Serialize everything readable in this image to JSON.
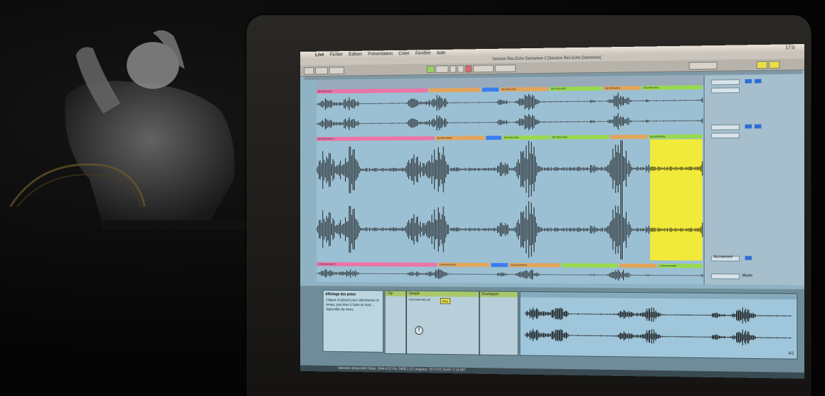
{
  "menu": {
    "app": "Live",
    "items": [
      "Fichier",
      "Édition",
      "Présentation",
      "Créer",
      "Fenêtre",
      "Aide"
    ],
    "clock": "17:0"
  },
  "window_title": "Session Rec.Echo Damonion 2  [Session Rec.Echo Damonion]",
  "tracks": {
    "top_clips": [
      "56 DPA 4021",
      "56 DPA 4021",
      "56 DPA 4021",
      "56 DPA 4021",
      "56 DPA 4021"
    ],
    "mid_clips": [
      "56 DPA 4061-1",
      "56 DPA 4061",
      "56 DPA 4061",
      "56 DPA 4061",
      "56 DPA 4061"
    ],
    "bottom_clips": [
      "2 Accouement 1",
      "2 Accouement",
      "2 Accouement",
      "2 Accouement"
    ],
    "bottom_lane_label": "Accouement"
  },
  "side": {
    "send_label": "Master",
    "lane_label": "Accouement"
  },
  "bottom": {
    "help_title": "Affichage des pistes",
    "help_text": "Cliquez et glissez pour sélectionner le temps, puis tirez à l'aide du bord ... disponible du menu.",
    "clip_title": "Clip",
    "sample_title": "Sample",
    "envelopes_title": "Enveloppes",
    "sample_name": "0103 DPA 4061.aif",
    "warp_label": "Warp",
    "page_indicator": "4/1"
  },
  "status_bar": "Sélection temporelle   Début: 0044.4.01   Fin: 0458.1.01   Longueur: 157.0.01   Durée: 5:14.697",
  "colors": {
    "screen_bg": "#8fb3c4",
    "clip_pink": "#ec74a7",
    "clip_green": "#9ad94e",
    "clip_blue": "#3a7df0",
    "clip_orange": "#e3a55a",
    "yellow_highlight": "#f1ea3a",
    "panel_green": "#a9c86a"
  }
}
